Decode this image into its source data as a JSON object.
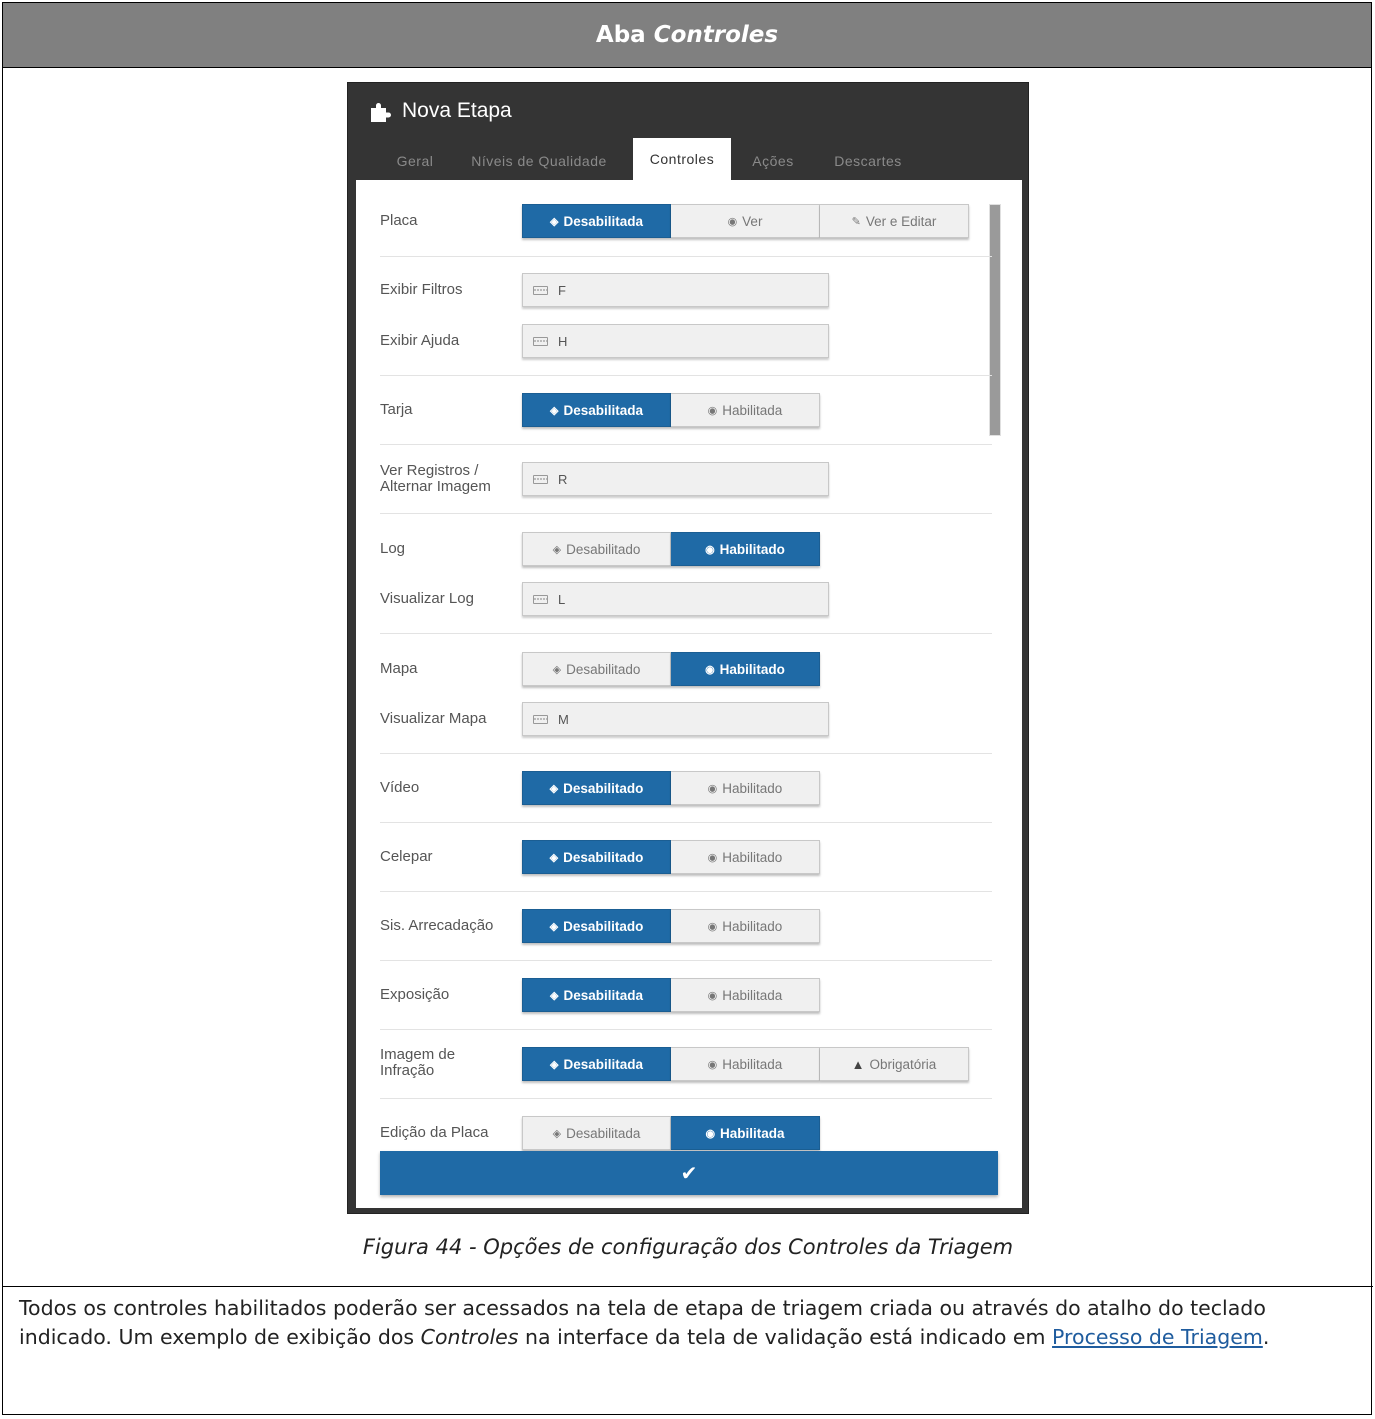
{
  "doc": {
    "header_prefix": "Aba",
    "header_emph": "Controles",
    "caption": "Figura 44 - Opções de configuração dos Controles da Triagem",
    "paragraph": {
      "part1": "Todos os controles habilitados poderão ser acessados na tela de etapa de triagem criada ou através do atalho do teclado indicado. Um exemplo de exibição dos ",
      "emph": "Controles",
      "part2": " na interface da tela de validação está indicado em ",
      "link": "Processo de Triagem",
      "end": "."
    }
  },
  "dialog": {
    "title": "Nova Etapa",
    "tabs": [
      "Geral",
      "Níveis de Qualidade",
      "Controles",
      "Ações",
      "Descartes"
    ],
    "active_tab": "Controles",
    "accent_color": "#1f6aa6"
  },
  "controls": {
    "placa": {
      "label": "Placa",
      "options": [
        "Desabilitada",
        "Ver",
        "Ver e Editar"
      ],
      "selected": "Desabilitada"
    },
    "exibir_filtros": {
      "label": "Exibir Filtros",
      "key": "F"
    },
    "exibir_ajuda": {
      "label": "Exibir Ajuda",
      "key": "H"
    },
    "tarja": {
      "label": "Tarja",
      "options": [
        "Desabilitada",
        "Habilitada"
      ],
      "selected": "Desabilitada"
    },
    "ver_registros": {
      "label_line1": "Ver Registros /",
      "label_line2": "Alternar Imagem",
      "key": "R"
    },
    "log": {
      "label": "Log",
      "options": [
        "Desabilitado",
        "Habilitado"
      ],
      "selected": "Habilitado"
    },
    "visualizar_log": {
      "label": "Visualizar Log",
      "key": "L"
    },
    "mapa": {
      "label": "Mapa",
      "options": [
        "Desabilitado",
        "Habilitado"
      ],
      "selected": "Habilitado"
    },
    "visualizar_mapa": {
      "label": "Visualizar Mapa",
      "key": "M"
    },
    "video": {
      "label": "Vídeo",
      "options": [
        "Desabilitado",
        "Habilitado"
      ],
      "selected": "Desabilitado"
    },
    "celepar": {
      "label": "Celepar",
      "options": [
        "Desabilitado",
        "Habilitado"
      ],
      "selected": "Desabilitado"
    },
    "sis_arrecadacao": {
      "label": "Sis. Arrecadação",
      "options": [
        "Desabilitado",
        "Habilitado"
      ],
      "selected": "Desabilitado"
    },
    "exposicao": {
      "label": "Exposição",
      "options": [
        "Desabilitada",
        "Habilitada"
      ],
      "selected": "Desabilitada"
    },
    "imagem_infracao": {
      "label_line1": "Imagem de",
      "label_line2": "Infração",
      "options": [
        "Desabilitada",
        "Habilitada",
        "Obrigatória"
      ],
      "selected": "Desabilitada"
    },
    "edicao_placa": {
      "label": "Edição da Placa",
      "options": [
        "Desabilitada",
        "Habilitada"
      ],
      "selected": "Habilitada"
    }
  },
  "icons": {
    "disabled": "eye-slash-icon",
    "enabled": "eye-icon",
    "edit": "pencil-icon",
    "required": "warning-icon",
    "keyboard": "keyboard-icon",
    "confirm": "check-icon",
    "title": "puzzle-icon"
  }
}
